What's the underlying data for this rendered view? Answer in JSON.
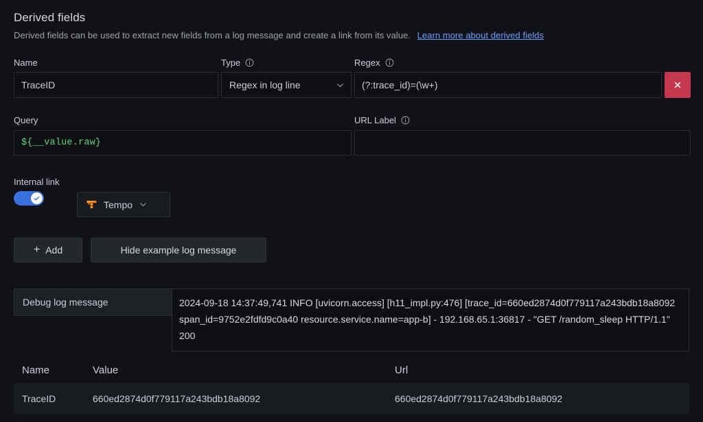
{
  "section": {
    "title": "Derived fields",
    "description": "Derived fields can be used to extract new fields from a log message and create a link from its value.",
    "learn_more_label": "Learn more about derived fields"
  },
  "fields": {
    "name": {
      "label": "Name",
      "value": "TraceID"
    },
    "type": {
      "label": "Type",
      "value": "Regex in log line",
      "has_info": true
    },
    "regex": {
      "label": "Regex",
      "value": "(?:trace_id)=(\\w+)",
      "has_info": true
    },
    "query": {
      "label": "Query",
      "value": "${__value.raw}"
    },
    "url_label": {
      "label": "URL Label",
      "value": "",
      "placeholder": "",
      "has_info": true
    },
    "internal_link": {
      "label": "Internal link",
      "enabled": true,
      "datasource": "Tempo"
    }
  },
  "actions": {
    "delete_label": "x",
    "add_label": "Add",
    "add_plus": "+",
    "toggle_example_label": "Hide example log message"
  },
  "debug": {
    "prefix_label": "Debug log message",
    "log_message": "2024-09-18 14:37:49,741 INFO [uvicorn.access] [h11_impl.py:476] [trace_id=660ed2874d0f779117a243bdb18a8092 span_id=9752e2fdfd9c0a40 resource.service.name=app-b] - 192.168.65.1:36817 - \"GET /random_sleep HTTP/1.1\" 200"
  },
  "preview_table": {
    "columns": [
      "Name",
      "Value",
      "Url"
    ],
    "rows": [
      {
        "name": "TraceID",
        "value": "660ed2874d0f779117a243bdb18a8092",
        "url": "660ed2874d0f779117a243bdb18a8092"
      }
    ]
  },
  "colors": {
    "background": "#111217",
    "input_background": "#0e0f13",
    "border": "#2d2f36",
    "accent_blue": "#3871dc",
    "link_blue": "#6e9fff",
    "danger_red": "#c4374f",
    "code_green": "#5fd47c",
    "tempo_orange": "#f5a623",
    "text_primary": "#ccccdc",
    "text_secondary": "#9fa3a8"
  }
}
